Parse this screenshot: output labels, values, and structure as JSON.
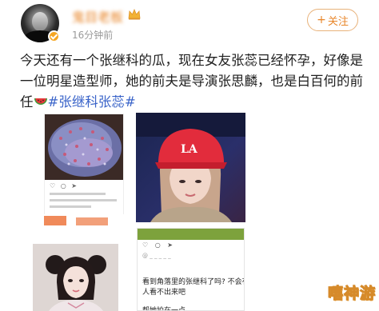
{
  "header": {
    "username": "鬼目老板",
    "timestamp": "16分钟前",
    "follow_label": "关注",
    "follow_plus": "+"
  },
  "post": {
    "text": "今天还有一个张继科的瓜，现在女友张蕊已经怀孕，好像是一位明星造型师，她的前夫是导演张思麟，也是白百何的前任",
    "hashtag": "#张继科张蕊#"
  },
  "screenshot_image": {
    "username_line": "@ _ _ _ _ _",
    "question_line1": "看到角落里的张继科了吗? 不会有",
    "question_line2": "人看不出来吧",
    "footer_line": "帮她拍在一点"
  },
  "watermark": {
    "text": "嘻神游"
  },
  "colors": {
    "accent": "#e8862a",
    "hashtag": "#3a64c9",
    "text": "#1e1e1e",
    "muted": "#9a9a9a"
  }
}
